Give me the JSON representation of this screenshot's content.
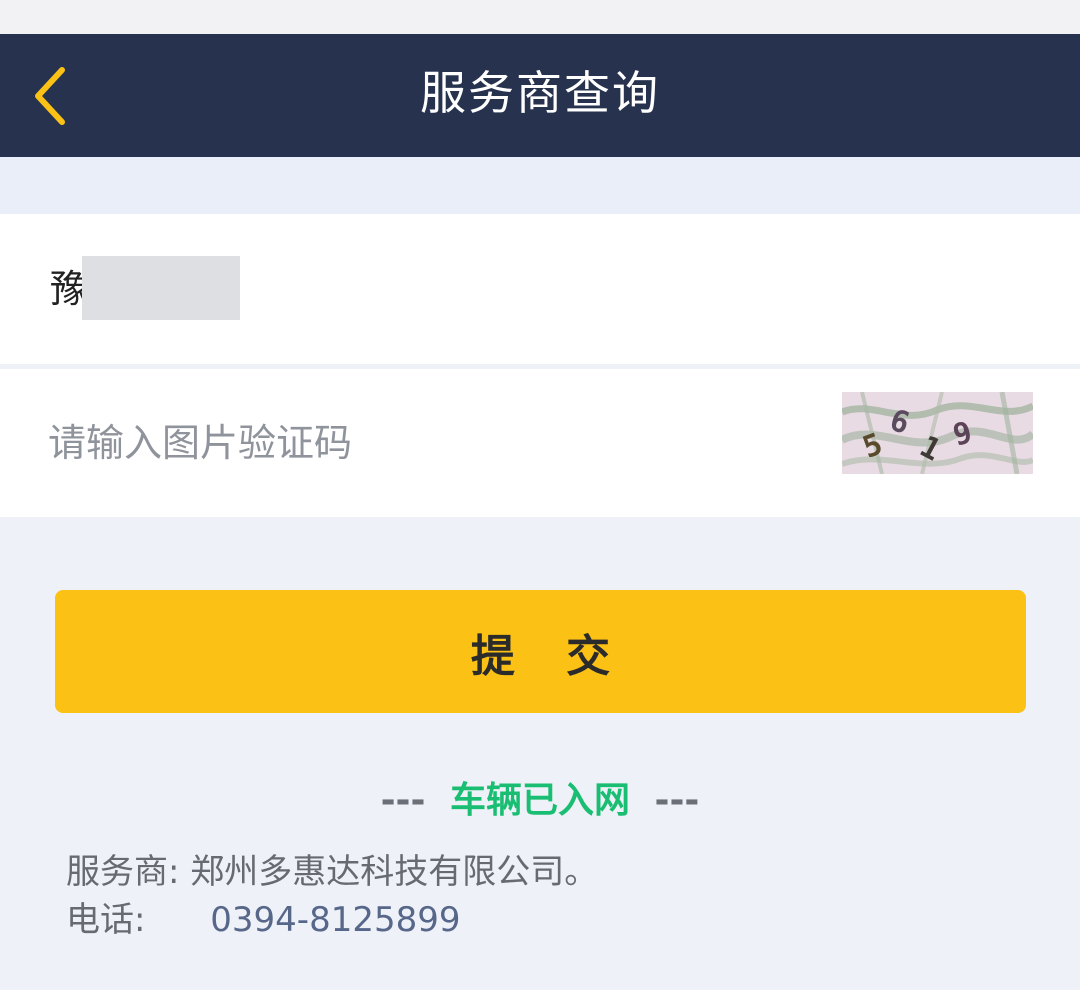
{
  "nav": {
    "title": "服务商查询",
    "back_icon": "chevron-left-icon",
    "accent_color": "#fbc114",
    "background_color": "#26324e"
  },
  "plate": {
    "prefix": "豫"
  },
  "captcha": {
    "placeholder": "请输入图片验证码",
    "value": "",
    "image_text": "5619"
  },
  "submit": {
    "label": "提 交",
    "color": "#fbc114"
  },
  "status": {
    "dash_left": "---",
    "text": "车辆已入网",
    "dash_right": "---",
    "color": "#19be72"
  },
  "provider": {
    "label": "服务商:",
    "name": "郑州多惠达科技有限公司。"
  },
  "phone": {
    "label": "电话:",
    "number": "0394-8125899"
  }
}
